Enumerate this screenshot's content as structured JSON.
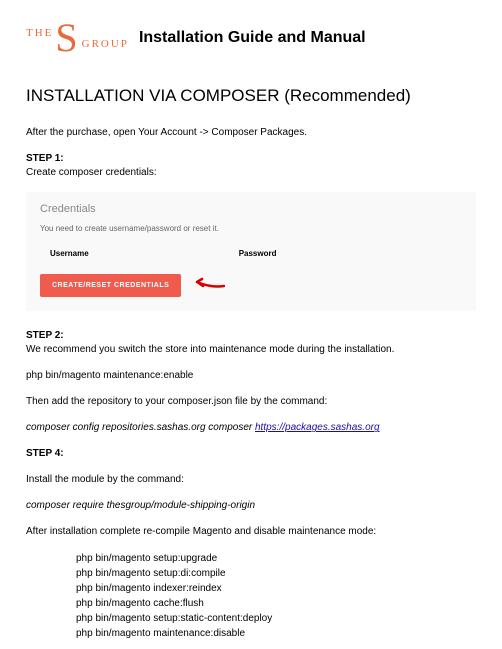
{
  "logo": {
    "the": "THE",
    "s": "S",
    "group": "GROUP"
  },
  "header_title": "Installation Guide and Manual",
  "section_title": "INSTALLATION VIA COMPOSER (Recommended)",
  "intro": "After the purchase, open Your Account -> Composer Packages.",
  "step1_label": "STEP 1:",
  "step1_text": "Create composer credentials:",
  "screenshot": {
    "title": "Credentials",
    "subtitle": "You need to create username/password or reset it.",
    "col_user": "Username",
    "col_pass": "Password",
    "button": "CREATE/RESET CREDENTIALS"
  },
  "step2_label": "STEP 2:",
  "step2_text": "We recommend you switch the store into maintenance mode during the installation.",
  "cmd_maint_enable": "php bin/magento maintenance:enable",
  "repo_text": "Then add the repository to your composer.json file by the command:",
  "cmd_repo_prefix": "composer config repositories.sashas.org composer ",
  "cmd_repo_link": "https://packages.sashas.org",
  "step4_label": "STEP 4:",
  "step4_text": "Install the module by the command:",
  "cmd_require": "composer require thesgroup/module-shipping-origin",
  "after_text": "After installation complete re-compile Magento and disable maintenance mode:",
  "final_cmds": {
    "c1": "php bin/magento setup:upgrade",
    "c2": "php bin/magento setup:di:compile",
    "c3": "php bin/magento indexer:reindex",
    "c4": "php bin/magento cache:flush",
    "c5": "php bin/magento setup:static-content:deploy",
    "c6": "php bin/magento maintenance:disable"
  }
}
